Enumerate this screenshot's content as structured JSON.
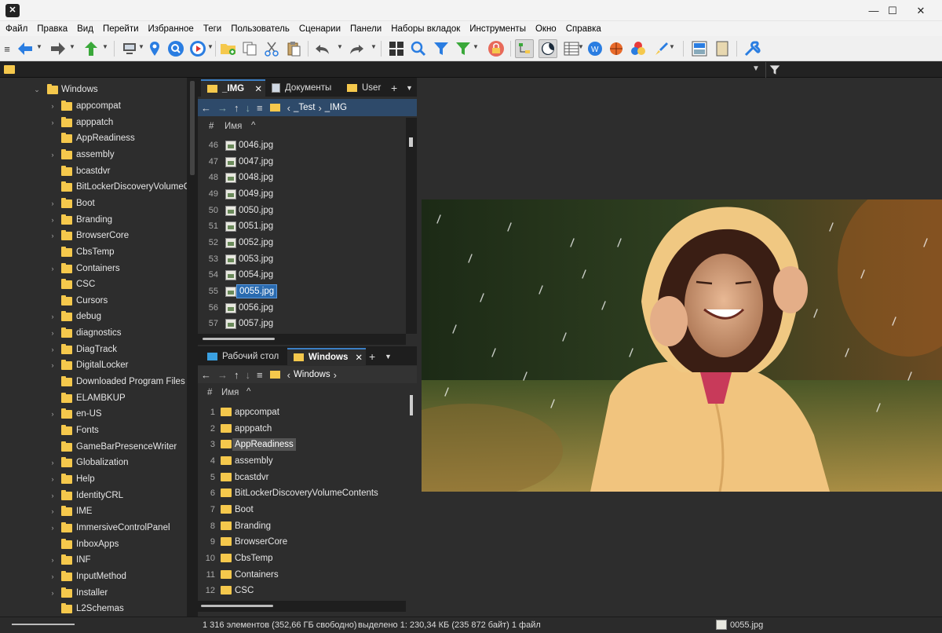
{
  "menu": [
    "Файл",
    "Правка",
    "Вид",
    "Перейти",
    "Избранное",
    "Теги",
    "Пользователь",
    "Сценарии",
    "Панели",
    "Наборы вкладок",
    "Инструменты",
    "Окно",
    "Справка"
  ],
  "window_controls": {
    "minimize": "—",
    "maximize": "☐",
    "close": "✕"
  },
  "app_logo": "✕",
  "toolbar_icons": [
    "menu-icon",
    "back-arrow-icon",
    "forward-arrow-icon",
    "up-arrow-icon",
    "computer-icon",
    "location-pin-icon",
    "search-circle-icon",
    "play-circle-icon",
    "new-folder-icon",
    "copy-icon",
    "cut-icon",
    "paste-icon",
    "undo-icon",
    "redo-icon",
    "layout-grid-icon",
    "search-icon",
    "filter-icon",
    "filter-green-icon",
    "lock-icon",
    "tree-toggle-icon",
    "dark-mode-icon",
    "details-view-icon",
    "badge-icon",
    "basketball-icon",
    "color-circles-icon",
    "brush-icon",
    "single-pane-icon",
    "dual-pane-icon",
    "tools-icon"
  ],
  "tree": {
    "root": "Windows",
    "items": [
      {
        "label": "appcompat",
        "expandable": true
      },
      {
        "label": "apppatch",
        "expandable": true
      },
      {
        "label": "AppReadiness",
        "expandable": false
      },
      {
        "label": "assembly",
        "expandable": true
      },
      {
        "label": "bcastdvr",
        "expandable": false
      },
      {
        "label": "BitLockerDiscoveryVolumeCo",
        "expandable": false
      },
      {
        "label": "Boot",
        "expandable": true
      },
      {
        "label": "Branding",
        "expandable": true
      },
      {
        "label": "BrowserCore",
        "expandable": true
      },
      {
        "label": "CbsTemp",
        "expandable": false
      },
      {
        "label": "Containers",
        "expandable": true
      },
      {
        "label": "CSC",
        "expandable": false
      },
      {
        "label": "Cursors",
        "expandable": false
      },
      {
        "label": "debug",
        "expandable": true
      },
      {
        "label": "diagnostics",
        "expandable": true
      },
      {
        "label": "DiagTrack",
        "expandable": true
      },
      {
        "label": "DigitalLocker",
        "expandable": true
      },
      {
        "label": "Downloaded Program Files",
        "expandable": false
      },
      {
        "label": "ELAMBKUP",
        "expandable": false
      },
      {
        "label": "en-US",
        "expandable": true
      },
      {
        "label": "Fonts",
        "expandable": false
      },
      {
        "label": "GameBarPresenceWriter",
        "expandable": false
      },
      {
        "label": "Globalization",
        "expandable": true
      },
      {
        "label": "Help",
        "expandable": true
      },
      {
        "label": "IdentityCRL",
        "expandable": true
      },
      {
        "label": "IME",
        "expandable": true
      },
      {
        "label": "ImmersiveControlPanel",
        "expandable": true
      },
      {
        "label": "InboxApps",
        "expandable": false
      },
      {
        "label": "INF",
        "expandable": true
      },
      {
        "label": "InputMethod",
        "expandable": true
      },
      {
        "label": "Installer",
        "expandable": true
      },
      {
        "label": "L2Schemas",
        "expandable": false
      }
    ]
  },
  "top_pane": {
    "tabs": [
      {
        "label": "_IMG",
        "active": true,
        "close": "✕"
      },
      {
        "label": "Документы",
        "active": false
      },
      {
        "label": "User",
        "active": false
      }
    ],
    "tab_add": "+",
    "breadcrumb": [
      "_Test",
      "_IMG"
    ],
    "col_num": "#",
    "col_name": "Имя",
    "sort_arrow": "^",
    "rows": [
      {
        "n": "46",
        "name": "0046.jpg"
      },
      {
        "n": "47",
        "name": "0047.jpg"
      },
      {
        "n": "48",
        "name": "0048.jpg"
      },
      {
        "n": "49",
        "name": "0049.jpg"
      },
      {
        "n": "50",
        "name": "0050.jpg"
      },
      {
        "n": "51",
        "name": "0051.jpg"
      },
      {
        "n": "52",
        "name": "0052.jpg"
      },
      {
        "n": "53",
        "name": "0053.jpg"
      },
      {
        "n": "54",
        "name": "0054.jpg"
      },
      {
        "n": "55",
        "name": "0055.jpg",
        "selected": true
      },
      {
        "n": "56",
        "name": "0056.jpg"
      },
      {
        "n": "57",
        "name": "0057.jpg"
      }
    ]
  },
  "bottom_pane": {
    "tabs": [
      {
        "label": "Рабочий стол",
        "active": false
      },
      {
        "label": "Windows",
        "active": true,
        "close": "✕"
      }
    ],
    "tab_add": "+",
    "breadcrumb": [
      "Windows"
    ],
    "col_num": "#",
    "col_name": "Имя",
    "sort_arrow": "^",
    "rows": [
      {
        "n": "1",
        "name": "appcompat"
      },
      {
        "n": "2",
        "name": "apppatch"
      },
      {
        "n": "3",
        "name": "AppReadiness",
        "highlight": true
      },
      {
        "n": "4",
        "name": "assembly"
      },
      {
        "n": "5",
        "name": "bcastdvr"
      },
      {
        "n": "6",
        "name": "BitLockerDiscoveryVolumeContents"
      },
      {
        "n": "7",
        "name": "Boot"
      },
      {
        "n": "8",
        "name": "Branding"
      },
      {
        "n": "9",
        "name": "BrowserCore"
      },
      {
        "n": "10",
        "name": "CbsTemp"
      },
      {
        "n": "11",
        "name": "Containers"
      },
      {
        "n": "12",
        "name": "CSC"
      }
    ]
  },
  "status": {
    "items_count": "1 316 элементов (352,66 ГБ свободно)",
    "selection": "выделено 1: 230,34 КБ (235 872 байт) 1 файл",
    "current_file": "0055.jpg"
  },
  "colors": {
    "accent": "#3c7fc4",
    "selection": "#2a6bb0",
    "folder": "#f5c84c",
    "navbar": "#2e4a6a"
  }
}
